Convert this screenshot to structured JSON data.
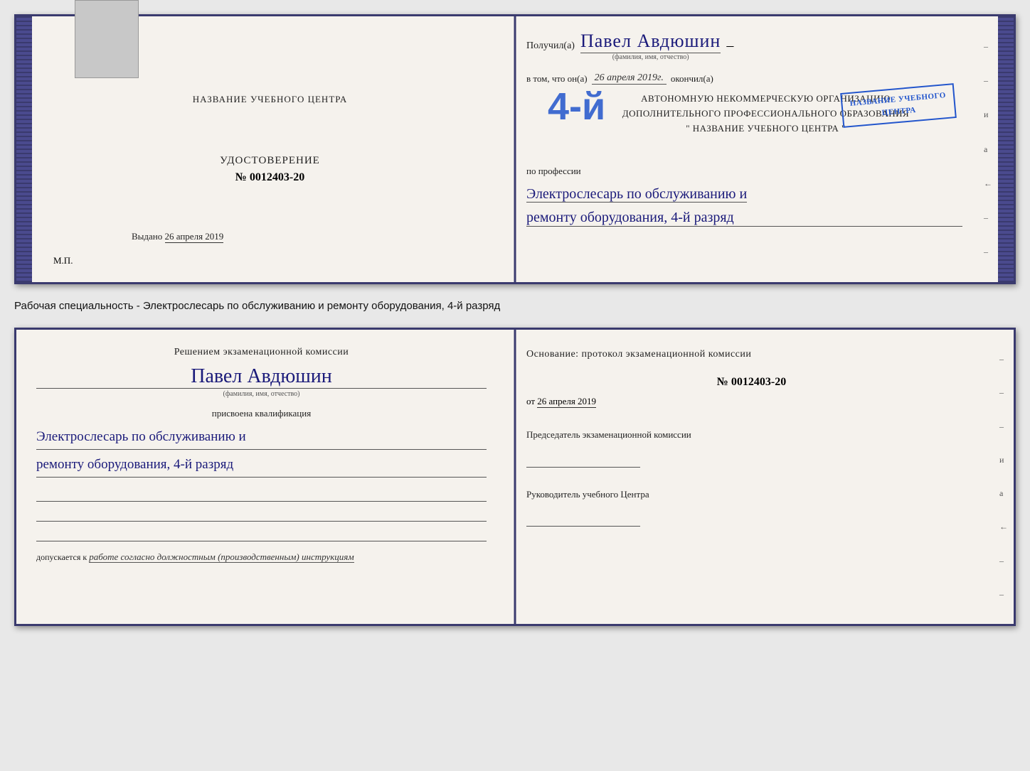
{
  "page": {
    "background": "#e8e8e8"
  },
  "top_cert": {
    "left": {
      "title": "НАЗВАНИЕ УЧЕБНОГО ЦЕНТРА",
      "doc_type": "УДОСТОВЕРЕНИЕ",
      "doc_number": "№ 0012403-20",
      "issued_label": "Выдано",
      "issued_date": "26 апреля 2019",
      "mp_label": "М.П."
    },
    "right": {
      "received_label": "Получил(а)",
      "name_handwritten": "Павел Авдюшин",
      "name_subtitle": "(фамилия, имя, отчество)",
      "vtom_label": "в том, что он(а)",
      "date_handwritten": "26 апреля 2019г.",
      "okончил_label": "окончил(а)",
      "grade_big": "4-й",
      "org_line1": "АВТОНОМНУЮ НЕКОММЕРЧЕСКУЮ ОРГАНИЗАЦИЮ",
      "org_line2": "ДОПОЛНИТЕЛЬНОГО ПРОФЕССИОНАЛЬНОГО ОБРАЗОВАНИЯ",
      "org_line3": "\" НАЗВАНИЕ УЧЕБНОГО ЦЕНТРА \"",
      "profession_label": "по профессии",
      "profession_line1": "Электрослесарь по обслуживанию и",
      "profession_line2": "ремонту оборудования, 4-й разряд"
    }
  },
  "description": {
    "text": "Рабочая специальность - Электрослесарь по обслуживанию и ремонту оборудования, 4-й разряд"
  },
  "bottom_cert": {
    "left": {
      "commission_title": "Решением экзаменационной комиссии",
      "name_handwritten": "Павел Авдюшин",
      "name_subtitle": "(фамилия, имя, отчество)",
      "assigned_label": "присвоена квалификация",
      "profession_line1": "Электрослесарь по обслуживанию и",
      "profession_line2": "ремонту оборудования, 4-й разряд",
      "допускается_prefix": "допускается к",
      "допускается_text": "работе согласно должностным (производственным) инструкциям"
    },
    "right": {
      "osnov_title": "Основание: протокол экзаменационной комиссии",
      "protocol_number": "№ 0012403-20",
      "date_prefix": "от",
      "date": "26 апреля 2019",
      "chairman_label": "Председатель экзаменационной комиссии",
      "director_label": "Руководитель учебного Центра"
    }
  },
  "side_labels": {
    "и": "и",
    "а": "а",
    "chevron": "←",
    "dashes": [
      "–",
      "–",
      "–",
      "–",
      "–",
      "–",
      "–"
    ]
  }
}
